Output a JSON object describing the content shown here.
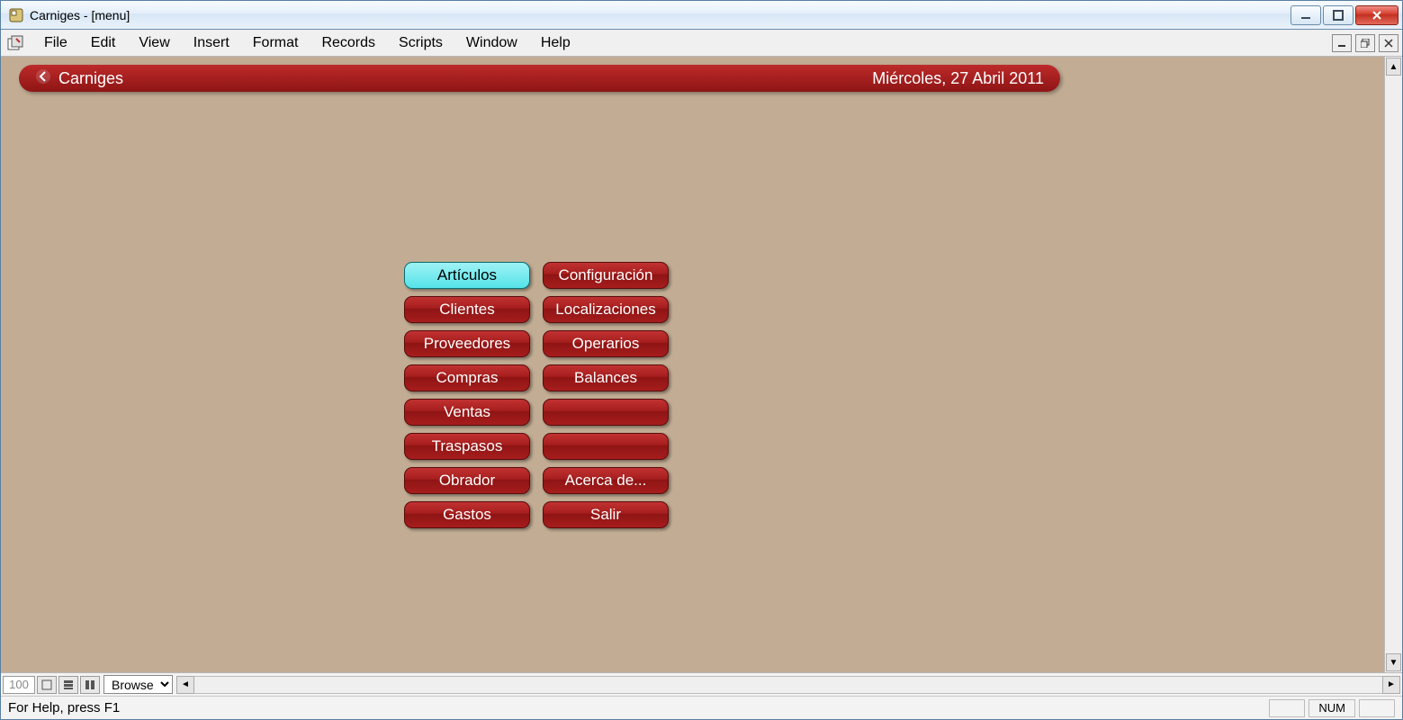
{
  "window": {
    "title": "Carniges - [menu]"
  },
  "menubar": {
    "items": [
      "File",
      "Edit",
      "View",
      "Insert",
      "Format",
      "Records",
      "Scripts",
      "Window",
      "Help"
    ]
  },
  "header": {
    "brand": "Carniges",
    "date": "Miércoles, 27 Abril 2011"
  },
  "buttons": {
    "left": [
      "Artículos",
      "Clientes",
      "Proveedores",
      "Compras",
      "Ventas",
      "Traspasos",
      "Obrador",
      "Gastos"
    ],
    "right": [
      "Configuración",
      "Localizaciones",
      "Operarios",
      "Balances",
      "",
      "",
      "Acerca de...",
      "Salir"
    ],
    "selected_index_left": 0
  },
  "bottom": {
    "zoom": "100",
    "mode": "Browse"
  },
  "status": {
    "help": "For Help, press F1",
    "indicators": [
      "",
      "NUM",
      ""
    ]
  }
}
